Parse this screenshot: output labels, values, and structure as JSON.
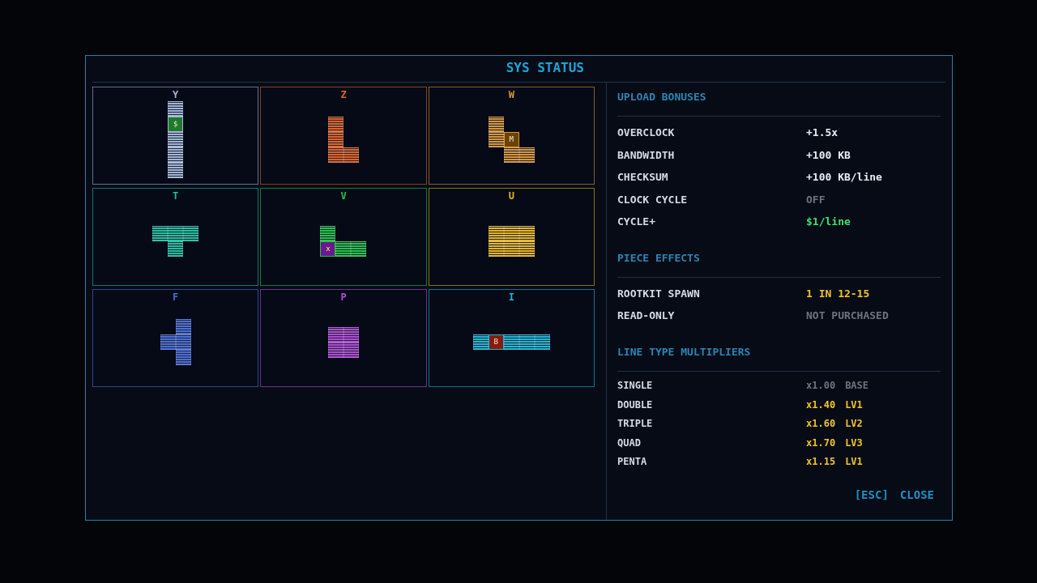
{
  "window": {
    "title": "SYS STATUS"
  },
  "pieces": [
    {
      "name": "Y",
      "color": "#9fb6d8",
      "rows": [
        [
          {
            "kind": "block"
          }
        ],
        [
          {
            "kind": "special",
            "label": "$",
            "color": "#1f7a2a"
          }
        ],
        [
          {
            "kind": "block"
          }
        ],
        [
          {
            "kind": "block"
          }
        ],
        [
          {
            "kind": "block"
          }
        ]
      ]
    },
    {
      "name": "Z",
      "color": "#e0622a",
      "rows": [
        [
          {
            "kind": "block"
          },
          {
            "kind": "empty"
          }
        ],
        [
          {
            "kind": "block"
          },
          {
            "kind": "empty"
          }
        ],
        [
          {
            "kind": "block"
          },
          {
            "kind": "block"
          }
        ]
      ]
    },
    {
      "name": "W",
      "color": "#d8953a",
      "rows": [
        [
          {
            "kind": "block"
          },
          {
            "kind": "empty"
          },
          {
            "kind": "empty"
          }
        ],
        [
          {
            "kind": "block"
          },
          {
            "kind": "special",
            "label": "M",
            "color": "#6a4208"
          },
          {
            "kind": "empty"
          }
        ],
        [
          {
            "kind": "empty"
          },
          {
            "kind": "block"
          },
          {
            "kind": "block"
          }
        ]
      ]
    },
    {
      "name": "T",
      "color": "#1fbfa0",
      "rows": [
        [
          {
            "kind": "block"
          },
          {
            "kind": "block"
          },
          {
            "kind": "block"
          }
        ],
        [
          {
            "kind": "empty"
          },
          {
            "kind": "block"
          },
          {
            "kind": "empty"
          }
        ]
      ]
    },
    {
      "name": "V",
      "color": "#22c24a",
      "rows": [
        [
          {
            "kind": "block"
          },
          {
            "kind": "empty"
          },
          {
            "kind": "empty"
          }
        ],
        [
          {
            "kind": "special",
            "label": "x",
            "color": "#6a1a8a"
          },
          {
            "kind": "block"
          },
          {
            "kind": "block"
          }
        ]
      ]
    },
    {
      "name": "U",
      "color": "#e6b422",
      "rows": [
        [
          {
            "kind": "block"
          },
          {
            "kind": "block"
          },
          {
            "kind": "block"
          }
        ],
        [
          {
            "kind": "block"
          },
          {
            "kind": "block"
          },
          {
            "kind": "block"
          }
        ]
      ]
    },
    {
      "name": "F",
      "color": "#4a6fdc",
      "rows": [
        [
          {
            "kind": "empty"
          },
          {
            "kind": "block"
          }
        ],
        [
          {
            "kind": "block"
          },
          {
            "kind": "block"
          }
        ],
        [
          {
            "kind": "empty"
          },
          {
            "kind": "block"
          }
        ]
      ]
    },
    {
      "name": "P",
      "color": "#b04ad8",
      "rows": [
        [
          {
            "kind": "block"
          },
          {
            "kind": "block"
          }
        ],
        [
          {
            "kind": "block"
          },
          {
            "kind": "block"
          }
        ]
      ]
    },
    {
      "name": "I",
      "color": "#18b8d8",
      "rows": [
        [
          {
            "kind": "block"
          },
          {
            "kind": "special",
            "label": "B",
            "color": "#8a1a10"
          },
          {
            "kind": "block"
          },
          {
            "kind": "block"
          },
          {
            "kind": "block"
          }
        ]
      ]
    }
  ],
  "sections": [
    {
      "title": "UPLOAD BONUSES",
      "rows": [
        {
          "label": "OVERCLOCK",
          "value": "+1.5x",
          "kind": "normal"
        },
        {
          "label": "BANDWIDTH",
          "value": "+100 KB",
          "kind": "normal"
        },
        {
          "label": "CHECKSUM",
          "value": "+100 KB/line",
          "kind": "normal"
        },
        {
          "label": "CLOCK CYCLE",
          "value": "OFF",
          "kind": "muted"
        },
        {
          "label": "CYCLE+",
          "value": "$1/line",
          "kind": "positive"
        }
      ]
    },
    {
      "title": "PIECE EFFECTS",
      "rows": [
        {
          "label": "ROOTKIT SPAWN",
          "value": "1 IN 12-15",
          "kind": "highlight"
        },
        {
          "label": "READ-ONLY",
          "value": "NOT PURCHASED",
          "kind": "muted"
        }
      ]
    },
    {
      "title": "LINE TYPE MULTIPLIERS",
      "rows": [
        {
          "label": "SINGLE",
          "value": "x1.00",
          "level_text": "BASE",
          "kind": "muted"
        },
        {
          "label": "DOUBLE",
          "value": "x1.40",
          "level_text": "LV1",
          "kind": "highlight"
        },
        {
          "label": "TRIPLE",
          "value": "x1.60",
          "level_text": "LV2",
          "kind": "highlight"
        },
        {
          "label": "QUAD",
          "value": "x1.70",
          "level_text": "LV3",
          "kind": "highlight"
        },
        {
          "label": "PENTA",
          "value": "x1.15",
          "level_text": "LV1",
          "kind": "highlight"
        }
      ]
    }
  ],
  "close": {
    "key": "[ESC]",
    "label": "CLOSE"
  }
}
